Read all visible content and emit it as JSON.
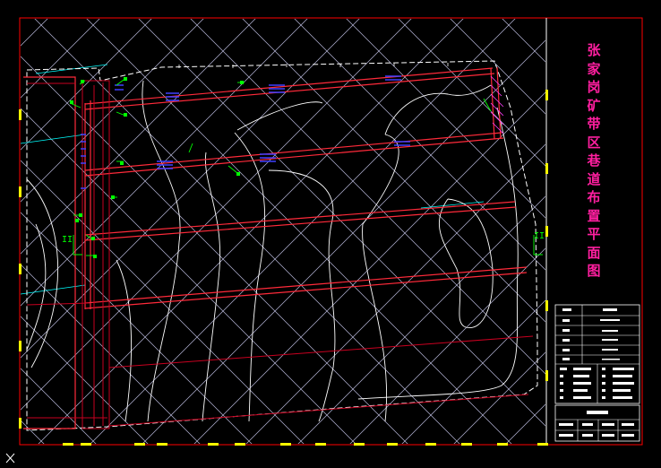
{
  "drawing": {
    "title_chars": [
      "张",
      "家",
      "岗",
      "矿",
      "带",
      "区",
      "巷",
      "道",
      "布",
      "置",
      "平",
      "面",
      "图"
    ],
    "section_marks": {
      "left": "II",
      "right": "II"
    },
    "ucs_icon": "ucs-axis-icon",
    "colors": {
      "background": "#000000",
      "frame": "#ff0000",
      "grid": "#d8d8ff",
      "cyan_grid": "#00ffff",
      "contour": "#ffffff",
      "roadway": "#ff2a3a",
      "roadway_dark": "#c80020",
      "title": "#ff1fa0",
      "marker": "#ffff00",
      "annotation": "#00ff00",
      "hatch": "#4040ff"
    }
  }
}
